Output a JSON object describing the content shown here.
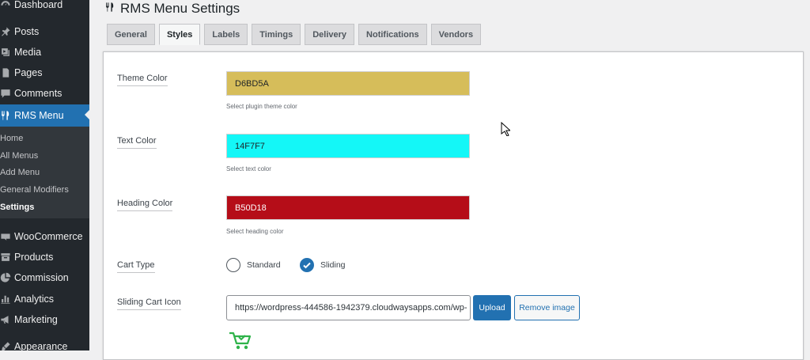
{
  "sidebar": {
    "items": [
      {
        "label": "Dashboard",
        "icon": "dashboard-icon"
      },
      {
        "label": "Posts",
        "icon": "pin-icon"
      },
      {
        "label": "Media",
        "icon": "media-icon"
      },
      {
        "label": "Pages",
        "icon": "pages-icon"
      },
      {
        "label": "Comments",
        "icon": "comment-icon"
      },
      {
        "label": "RMS Menu",
        "icon": "utensils-icon"
      },
      {
        "label": "WooCommerce",
        "icon": "woo-icon"
      },
      {
        "label": "Products",
        "icon": "archive-icon"
      },
      {
        "label": "Commission",
        "icon": "pie-icon"
      },
      {
        "label": "Analytics",
        "icon": "bar-chart-icon"
      },
      {
        "label": "Marketing",
        "icon": "megaphone-icon"
      },
      {
        "label": "Appearance",
        "icon": "brush-icon"
      }
    ],
    "submenu": [
      "Home",
      "All Menus",
      "Add Menu",
      "General Modifiers",
      "Settings"
    ],
    "active_color": "#2271b1"
  },
  "page": {
    "title": "RMS Menu Settings",
    "title_icon": "utensils-icon"
  },
  "tabs": [
    "General",
    "Styles",
    "Labels",
    "Timings",
    "Delivery",
    "Notifications",
    "Vendors"
  ],
  "active_tab": "Styles",
  "form": {
    "theme_color": {
      "label": "Theme Color",
      "value": "D6BD5A",
      "hex": "#D6BD5A",
      "desc": "Select plugin theme color"
    },
    "text_color": {
      "label": "Text Color",
      "value": "14F7F7",
      "hex": "#14F7F7",
      "desc": "Select text color"
    },
    "heading_color": {
      "label": "Heading Color",
      "value": "B50D18",
      "hex": "#B50D18",
      "desc": "Select heading color"
    },
    "cart_type": {
      "label": "Cart Type",
      "options": [
        "Standard",
        "Sliding"
      ],
      "selected": "Sliding"
    },
    "sliding_cart_icon": {
      "label": "Sliding Cart Icon",
      "url": "https://wordpress-444586-1942379.cloudwaysapps.com/wp-",
      "upload_label": "Upload",
      "remove_label": "Remove image",
      "preview_icon": "cart-check-icon"
    }
  }
}
